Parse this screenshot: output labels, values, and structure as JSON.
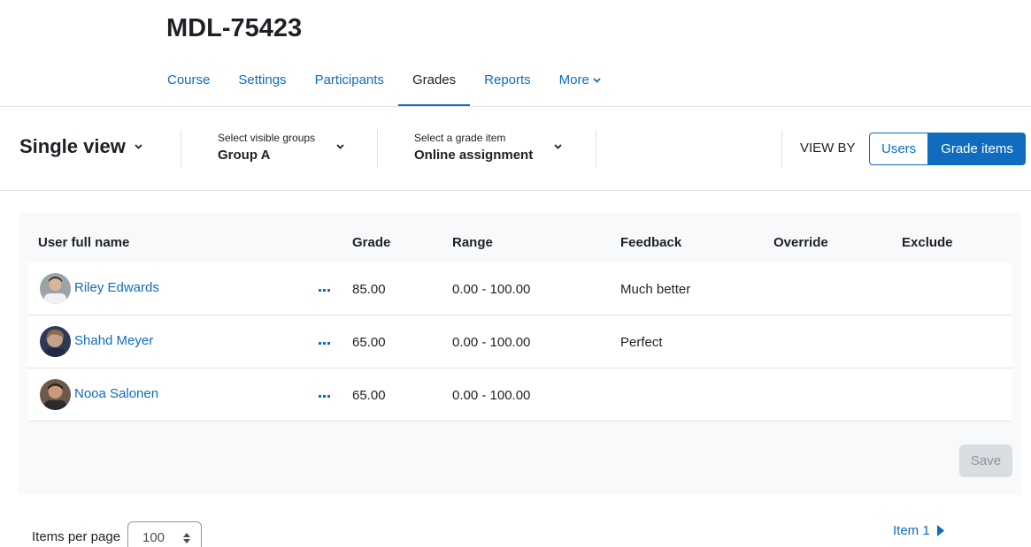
{
  "course": {
    "title": "MDL-75423"
  },
  "nav": {
    "tabs": [
      {
        "label": "Course"
      },
      {
        "label": "Settings"
      },
      {
        "label": "Participants"
      },
      {
        "label": "Grades",
        "active": true
      },
      {
        "label": "Reports"
      },
      {
        "label": "More"
      }
    ]
  },
  "toolbar": {
    "view_title": "Single view",
    "groups": {
      "label": "Select visible groups",
      "value": "Group A"
    },
    "grade_item": {
      "label": "Select a grade item",
      "value": "Online assignment"
    },
    "view_by": {
      "label": "VIEW BY",
      "options": [
        {
          "label": "Users",
          "selected": false
        },
        {
          "label": "Grade items",
          "selected": true
        }
      ]
    }
  },
  "table": {
    "headers": {
      "name": "User full name",
      "grade": "Grade",
      "range": "Range",
      "feedback": "Feedback",
      "override": "Override",
      "exclude": "Exclude"
    },
    "rows": [
      {
        "name": "Riley Edwards",
        "grade": "85.00",
        "range": "0.00 - 100.00",
        "feedback": "Much better"
      },
      {
        "name": "Shahd Meyer",
        "grade": "65.00",
        "range": "0.00 - 100.00",
        "feedback": "Perfect"
      },
      {
        "name": "Nooa Salonen",
        "grade": "65.00",
        "range": "0.00 - 100.00",
        "feedback": ""
      }
    ],
    "save_label": "Save"
  },
  "footer": {
    "items_per_page_label": "Items per page",
    "items_per_page_value": "100",
    "pager_label": "Item 1"
  },
  "colors": {
    "primary": "#0f6cbf",
    "text": "#1d2125",
    "border": "#dee2e6",
    "panel_bg": "#f8f9fa"
  },
  "icons": {
    "dropdown": "chevron-down-icon",
    "actions": "ellipsis-icon",
    "next": "caret-right-icon",
    "select": "sort-arrows-icon"
  }
}
